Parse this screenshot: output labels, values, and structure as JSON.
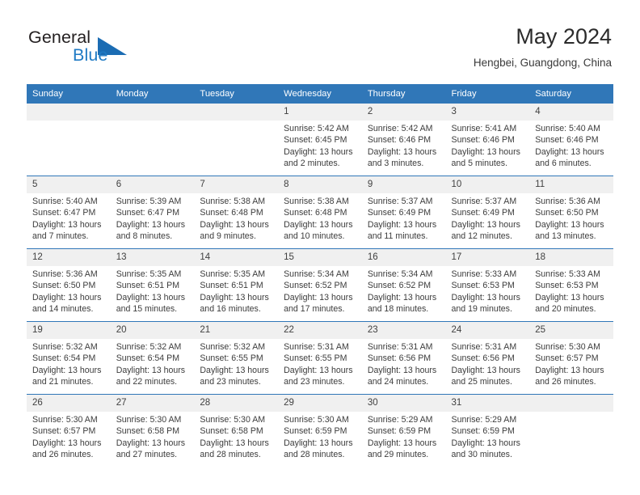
{
  "brand": {
    "word_one": "General",
    "word_two": "Blue",
    "triangle_icon": "triangle-logo-icon",
    "accent_color": "#1b6cb3"
  },
  "header": {
    "title": "May 2024",
    "subtitle": "Hengbei, Guangdong, China"
  },
  "calendar": {
    "header_bg": "#3077b8",
    "daynum_bg": "#f0f0f0",
    "weekdays": [
      "Sunday",
      "Monday",
      "Tuesday",
      "Wednesday",
      "Thursday",
      "Friday",
      "Saturday"
    ],
    "weeks": [
      [
        {
          "day": "",
          "empty": true,
          "sunrise": "",
          "sunset": "",
          "daylight1": "",
          "daylight2": ""
        },
        {
          "day": "",
          "empty": true,
          "sunrise": "",
          "sunset": "",
          "daylight1": "",
          "daylight2": ""
        },
        {
          "day": "",
          "empty": true,
          "sunrise": "",
          "sunset": "",
          "daylight1": "",
          "daylight2": ""
        },
        {
          "day": "1",
          "empty": false,
          "sunrise": "Sunrise: 5:42 AM",
          "sunset": "Sunset: 6:45 PM",
          "daylight1": "Daylight: 13 hours",
          "daylight2": "and 2 minutes."
        },
        {
          "day": "2",
          "empty": false,
          "sunrise": "Sunrise: 5:42 AM",
          "sunset": "Sunset: 6:46 PM",
          "daylight1": "Daylight: 13 hours",
          "daylight2": "and 3 minutes."
        },
        {
          "day": "3",
          "empty": false,
          "sunrise": "Sunrise: 5:41 AM",
          "sunset": "Sunset: 6:46 PM",
          "daylight1": "Daylight: 13 hours",
          "daylight2": "and 5 minutes."
        },
        {
          "day": "4",
          "empty": false,
          "sunrise": "Sunrise: 5:40 AM",
          "sunset": "Sunset: 6:46 PM",
          "daylight1": "Daylight: 13 hours",
          "daylight2": "and 6 minutes."
        }
      ],
      [
        {
          "day": "5",
          "empty": false,
          "sunrise": "Sunrise: 5:40 AM",
          "sunset": "Sunset: 6:47 PM",
          "daylight1": "Daylight: 13 hours",
          "daylight2": "and 7 minutes."
        },
        {
          "day": "6",
          "empty": false,
          "sunrise": "Sunrise: 5:39 AM",
          "sunset": "Sunset: 6:47 PM",
          "daylight1": "Daylight: 13 hours",
          "daylight2": "and 8 minutes."
        },
        {
          "day": "7",
          "empty": false,
          "sunrise": "Sunrise: 5:38 AM",
          "sunset": "Sunset: 6:48 PM",
          "daylight1": "Daylight: 13 hours",
          "daylight2": "and 9 minutes."
        },
        {
          "day": "8",
          "empty": false,
          "sunrise": "Sunrise: 5:38 AM",
          "sunset": "Sunset: 6:48 PM",
          "daylight1": "Daylight: 13 hours",
          "daylight2": "and 10 minutes."
        },
        {
          "day": "9",
          "empty": false,
          "sunrise": "Sunrise: 5:37 AM",
          "sunset": "Sunset: 6:49 PM",
          "daylight1": "Daylight: 13 hours",
          "daylight2": "and 11 minutes."
        },
        {
          "day": "10",
          "empty": false,
          "sunrise": "Sunrise: 5:37 AM",
          "sunset": "Sunset: 6:49 PM",
          "daylight1": "Daylight: 13 hours",
          "daylight2": "and 12 minutes."
        },
        {
          "day": "11",
          "empty": false,
          "sunrise": "Sunrise: 5:36 AM",
          "sunset": "Sunset: 6:50 PM",
          "daylight1": "Daylight: 13 hours",
          "daylight2": "and 13 minutes."
        }
      ],
      [
        {
          "day": "12",
          "empty": false,
          "sunrise": "Sunrise: 5:36 AM",
          "sunset": "Sunset: 6:50 PM",
          "daylight1": "Daylight: 13 hours",
          "daylight2": "and 14 minutes."
        },
        {
          "day": "13",
          "empty": false,
          "sunrise": "Sunrise: 5:35 AM",
          "sunset": "Sunset: 6:51 PM",
          "daylight1": "Daylight: 13 hours",
          "daylight2": "and 15 minutes."
        },
        {
          "day": "14",
          "empty": false,
          "sunrise": "Sunrise: 5:35 AM",
          "sunset": "Sunset: 6:51 PM",
          "daylight1": "Daylight: 13 hours",
          "daylight2": "and 16 minutes."
        },
        {
          "day": "15",
          "empty": false,
          "sunrise": "Sunrise: 5:34 AM",
          "sunset": "Sunset: 6:52 PM",
          "daylight1": "Daylight: 13 hours",
          "daylight2": "and 17 minutes."
        },
        {
          "day": "16",
          "empty": false,
          "sunrise": "Sunrise: 5:34 AM",
          "sunset": "Sunset: 6:52 PM",
          "daylight1": "Daylight: 13 hours",
          "daylight2": "and 18 minutes."
        },
        {
          "day": "17",
          "empty": false,
          "sunrise": "Sunrise: 5:33 AM",
          "sunset": "Sunset: 6:53 PM",
          "daylight1": "Daylight: 13 hours",
          "daylight2": "and 19 minutes."
        },
        {
          "day": "18",
          "empty": false,
          "sunrise": "Sunrise: 5:33 AM",
          "sunset": "Sunset: 6:53 PM",
          "daylight1": "Daylight: 13 hours",
          "daylight2": "and 20 minutes."
        }
      ],
      [
        {
          "day": "19",
          "empty": false,
          "sunrise": "Sunrise: 5:32 AM",
          "sunset": "Sunset: 6:54 PM",
          "daylight1": "Daylight: 13 hours",
          "daylight2": "and 21 minutes."
        },
        {
          "day": "20",
          "empty": false,
          "sunrise": "Sunrise: 5:32 AM",
          "sunset": "Sunset: 6:54 PM",
          "daylight1": "Daylight: 13 hours",
          "daylight2": "and 22 minutes."
        },
        {
          "day": "21",
          "empty": false,
          "sunrise": "Sunrise: 5:32 AM",
          "sunset": "Sunset: 6:55 PM",
          "daylight1": "Daylight: 13 hours",
          "daylight2": "and 23 minutes."
        },
        {
          "day": "22",
          "empty": false,
          "sunrise": "Sunrise: 5:31 AM",
          "sunset": "Sunset: 6:55 PM",
          "daylight1": "Daylight: 13 hours",
          "daylight2": "and 23 minutes."
        },
        {
          "day": "23",
          "empty": false,
          "sunrise": "Sunrise: 5:31 AM",
          "sunset": "Sunset: 6:56 PM",
          "daylight1": "Daylight: 13 hours",
          "daylight2": "and 24 minutes."
        },
        {
          "day": "24",
          "empty": false,
          "sunrise": "Sunrise: 5:31 AM",
          "sunset": "Sunset: 6:56 PM",
          "daylight1": "Daylight: 13 hours",
          "daylight2": "and 25 minutes."
        },
        {
          "day": "25",
          "empty": false,
          "sunrise": "Sunrise: 5:30 AM",
          "sunset": "Sunset: 6:57 PM",
          "daylight1": "Daylight: 13 hours",
          "daylight2": "and 26 minutes."
        }
      ],
      [
        {
          "day": "26",
          "empty": false,
          "sunrise": "Sunrise: 5:30 AM",
          "sunset": "Sunset: 6:57 PM",
          "daylight1": "Daylight: 13 hours",
          "daylight2": "and 26 minutes."
        },
        {
          "day": "27",
          "empty": false,
          "sunrise": "Sunrise: 5:30 AM",
          "sunset": "Sunset: 6:58 PM",
          "daylight1": "Daylight: 13 hours",
          "daylight2": "and 27 minutes."
        },
        {
          "day": "28",
          "empty": false,
          "sunrise": "Sunrise: 5:30 AM",
          "sunset": "Sunset: 6:58 PM",
          "daylight1": "Daylight: 13 hours",
          "daylight2": "and 28 minutes."
        },
        {
          "day": "29",
          "empty": false,
          "sunrise": "Sunrise: 5:30 AM",
          "sunset": "Sunset: 6:59 PM",
          "daylight1": "Daylight: 13 hours",
          "daylight2": "and 28 minutes."
        },
        {
          "day": "30",
          "empty": false,
          "sunrise": "Sunrise: 5:29 AM",
          "sunset": "Sunset: 6:59 PM",
          "daylight1": "Daylight: 13 hours",
          "daylight2": "and 29 minutes."
        },
        {
          "day": "31",
          "empty": false,
          "sunrise": "Sunrise: 5:29 AM",
          "sunset": "Sunset: 6:59 PM",
          "daylight1": "Daylight: 13 hours",
          "daylight2": "and 30 minutes."
        },
        {
          "day": "",
          "empty": true,
          "sunrise": "",
          "sunset": "",
          "daylight1": "",
          "daylight2": ""
        }
      ]
    ]
  }
}
